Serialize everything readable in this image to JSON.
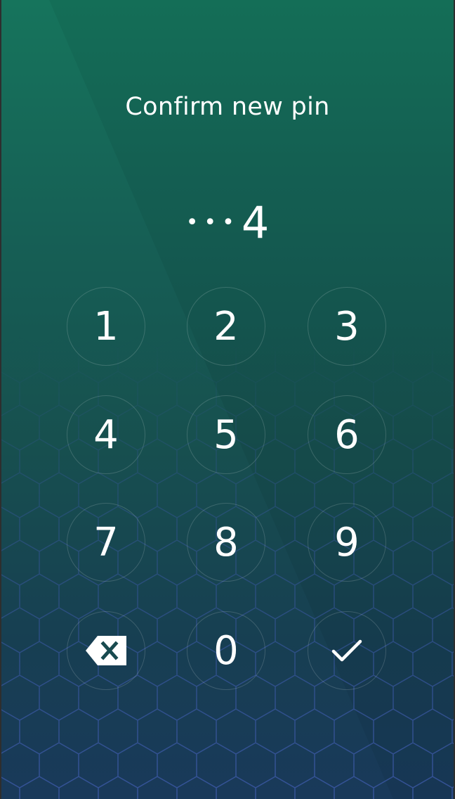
{
  "title": "Confirm new pin",
  "pin": {
    "masked": "•••",
    "last_digit": "4"
  },
  "keypad": {
    "k1": "1",
    "k2": "2",
    "k3": "3",
    "k4": "4",
    "k5": "5",
    "k6": "6",
    "k7": "7",
    "k8": "8",
    "k9": "9",
    "k0": "0",
    "delete_icon": "backspace-icon",
    "confirm_icon": "checkmark-icon"
  },
  "colors": {
    "background_top": "#16745c",
    "background_bottom": "#19395a",
    "text": "#ffffff"
  }
}
